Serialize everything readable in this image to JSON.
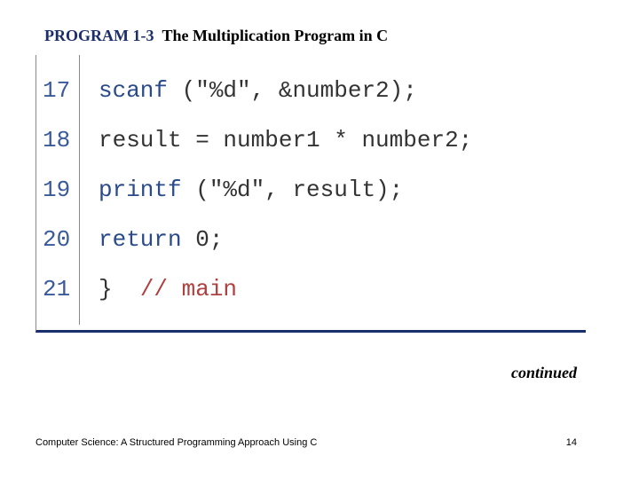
{
  "title": {
    "label": "PROGRAM 1-3",
    "text": "The Multiplication Program in C"
  },
  "code": {
    "lines": [
      {
        "no": "17",
        "kw": "scanf",
        "rest": " (\"%d\", &number2);"
      },
      {
        "no": "18",
        "kw": "",
        "rest": "result = number1 * number2;"
      },
      {
        "no": "19",
        "kw": "printf",
        "rest": " (\"%d\", result);"
      },
      {
        "no": "20",
        "kw": "return",
        "rest": " 0;"
      },
      {
        "no": "21",
        "kw": "",
        "rest": "}  ",
        "cmt": "// main"
      }
    ]
  },
  "continued": "continued",
  "footer": {
    "left": "Computer Science: A Structured Programming Approach Using C",
    "page": "14"
  }
}
